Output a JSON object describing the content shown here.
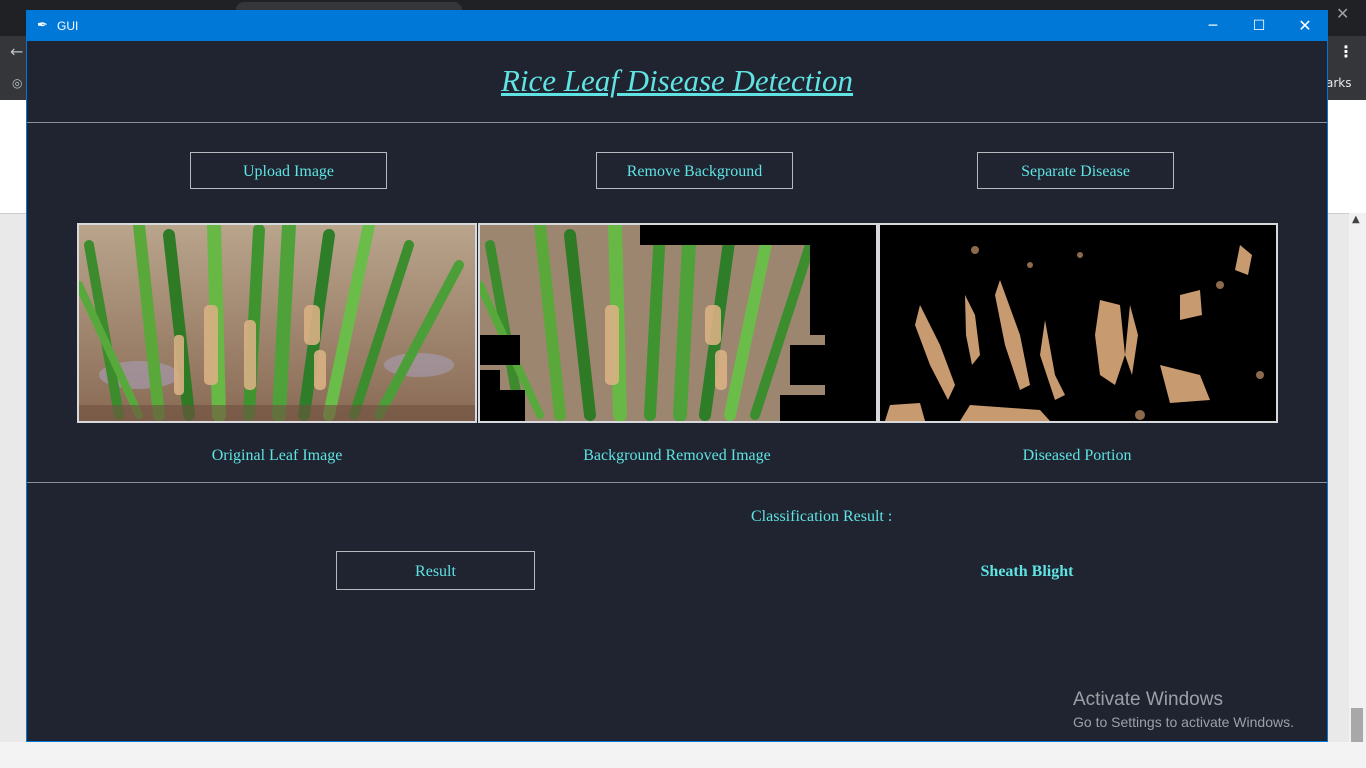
{
  "browser": {
    "back_icon": "arrow-left-icon",
    "menu_icon": "kebab-menu-icon",
    "bookmarks_fragment": "arks",
    "close_glyph": "✕"
  },
  "window": {
    "title": "GUI",
    "app_icon": "feather-icon",
    "controls": {
      "minimize": "─",
      "maximize": "☐",
      "close": "✕"
    }
  },
  "header": {
    "title": "Rice Leaf Disease Detection"
  },
  "toolbar": {
    "upload_label": "Upload Image",
    "remove_label": "Remove Background",
    "separate_label": "Separate Disease"
  },
  "panels": [
    {
      "caption": "Original Leaf Image"
    },
    {
      "caption": "Background Removed Image"
    },
    {
      "caption": "Diseased Portion"
    }
  ],
  "classification": {
    "label": "Classification Result :",
    "value": "Sheath Blight",
    "button_label": "Result"
  },
  "watermark": {
    "line1": "Activate Windows",
    "line2": "Go to Settings to activate Windows."
  },
  "colors": {
    "window_bg": "#1f2430",
    "accent_text": "#5fe3e3",
    "titlebar": "#0078d7"
  }
}
